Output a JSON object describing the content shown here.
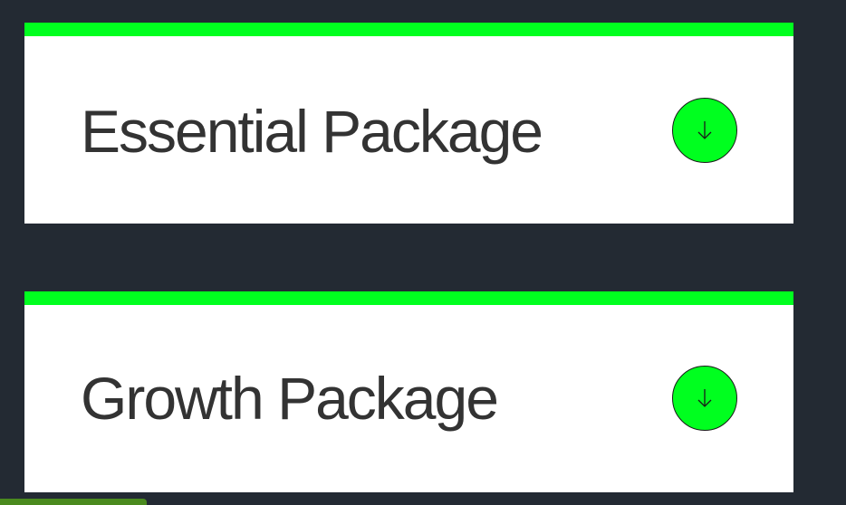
{
  "colors": {
    "background": "#232a33",
    "card": "#ffffff",
    "accent": "#00ff1f",
    "title_text": "#333333",
    "bottom_strip": "#4a8a1e"
  },
  "packages": [
    {
      "title": "Essential Package",
      "icon": "arrow-down-circle-icon"
    },
    {
      "title": "Growth Package",
      "icon": "arrow-down-circle-icon"
    }
  ]
}
